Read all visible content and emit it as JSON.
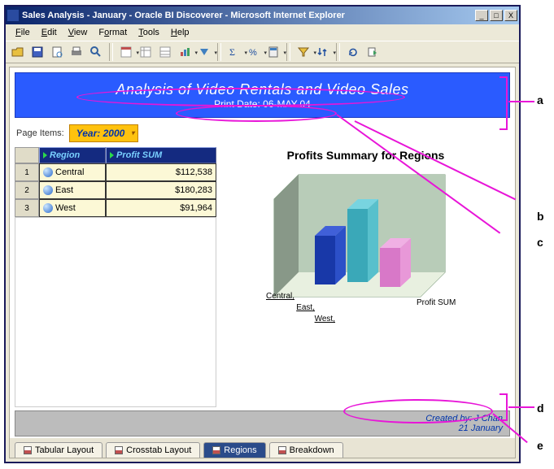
{
  "window": {
    "title": "Sales Analysis - January - Oracle BI Discoverer - Microsoft Internet Explorer"
  },
  "menu": [
    "File",
    "Edit",
    "View",
    "Format",
    "Tools",
    "Help"
  ],
  "banner": {
    "title": "Analysis of Video Rentals and Video Sales",
    "subtitle": "Print Date: 06-MAY-04"
  },
  "page_items_label": "Page Items:",
  "year_selector": "Year:  2000",
  "table": {
    "headers": {
      "col1": "Region",
      "col2": "Profit SUM"
    },
    "rows": [
      {
        "n": "1",
        "region": "Central",
        "profit": "$112,538"
      },
      {
        "n": "2",
        "region": "East",
        "profit": "$180,283"
      },
      {
        "n": "3",
        "region": "West",
        "profit": "$91,964"
      }
    ]
  },
  "chart": {
    "title": "Profits Summary for Regions",
    "axis_label": "Profit SUM",
    "categories": [
      "Central,",
      "East,",
      "West,"
    ]
  },
  "chart_data": {
    "type": "bar",
    "title": "Profits Summary for Regions",
    "categories": [
      "Central",
      "East",
      "West"
    ],
    "values": [
      112538,
      180283,
      91964
    ],
    "ylabel": "Profit SUM",
    "ylim": [
      0,
      200000
    ]
  },
  "footer": {
    "line1": "Created by: J Chan",
    "line2": "21 January"
  },
  "tabs": [
    "Tabular Layout",
    "Crosstab Layout",
    "Regions",
    "Breakdown"
  ],
  "annotations": {
    "a": "a",
    "b": "b",
    "c": "c",
    "d": "d",
    "e": "e"
  }
}
